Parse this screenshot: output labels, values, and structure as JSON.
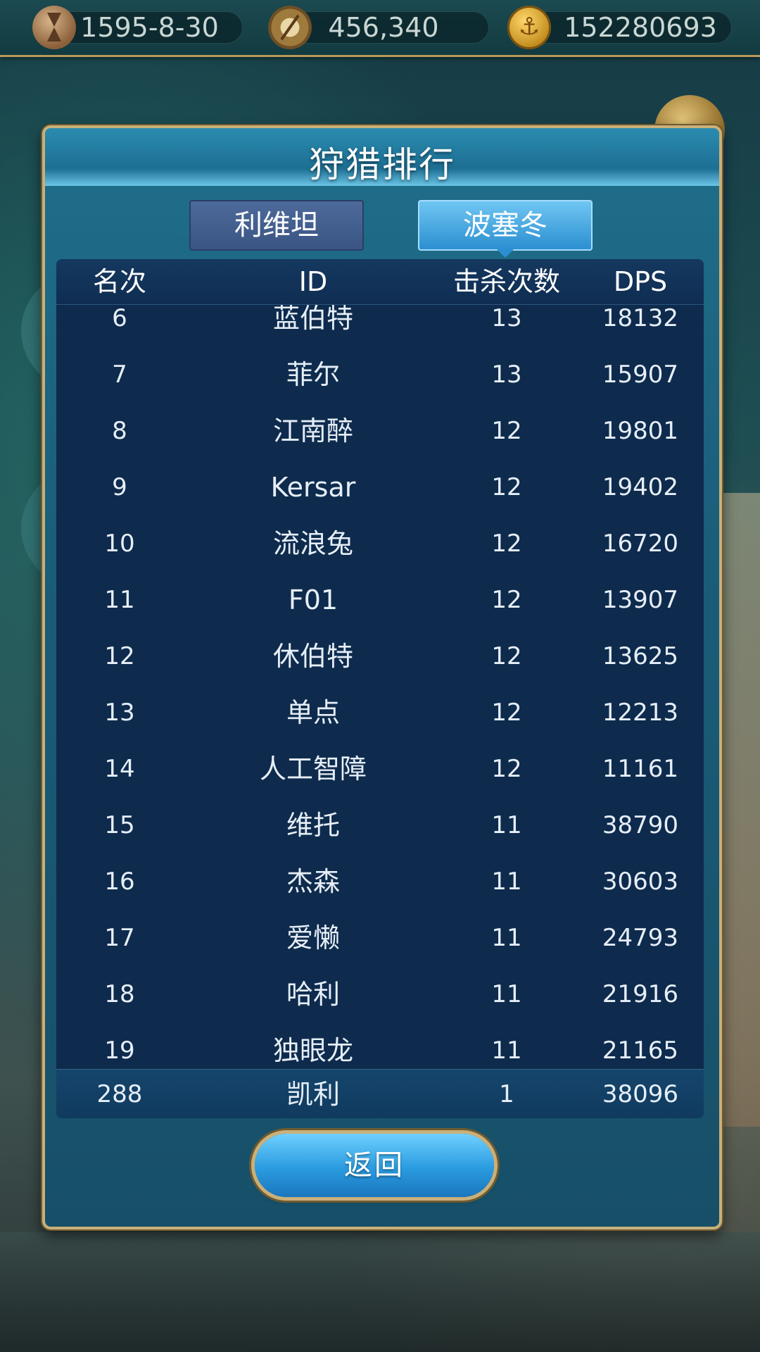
{
  "resources": {
    "date": "1595-8-30",
    "compass_value": "456,340",
    "gold": "152280693"
  },
  "panel": {
    "title": "狩猎排行",
    "tabs": [
      "利维坦",
      "波塞冬"
    ],
    "selected_tab": "波塞冬"
  },
  "table": {
    "headers": [
      "名次",
      "ID",
      "击杀次数",
      "DPS"
    ],
    "rows": [
      {
        "rank": "6",
        "name": "蓝伯特",
        "kills": "13",
        "dps": "18132"
      },
      {
        "rank": "7",
        "name": "菲尔",
        "kills": "13",
        "dps": "15907"
      },
      {
        "rank": "8",
        "name": "江南醉",
        "kills": "12",
        "dps": "19801"
      },
      {
        "rank": "9",
        "name": "Kersar",
        "kills": "12",
        "dps": "19402"
      },
      {
        "rank": "10",
        "name": "流浪兔",
        "kills": "12",
        "dps": "16720"
      },
      {
        "rank": "11",
        "name": "F01",
        "kills": "12",
        "dps": "13907"
      },
      {
        "rank": "12",
        "name": "休伯特",
        "kills": "12",
        "dps": "13625"
      },
      {
        "rank": "13",
        "name": "单点",
        "kills": "12",
        "dps": "12213"
      },
      {
        "rank": "14",
        "name": "人工智障",
        "kills": "12",
        "dps": "11161"
      },
      {
        "rank": "15",
        "name": "维托",
        "kills": "11",
        "dps": "38790"
      },
      {
        "rank": "16",
        "name": "杰森",
        "kills": "11",
        "dps": "30603"
      },
      {
        "rank": "17",
        "name": "爱懒",
        "kills": "11",
        "dps": "24793"
      },
      {
        "rank": "18",
        "name": "哈利",
        "kills": "11",
        "dps": "21916"
      },
      {
        "rank": "19",
        "name": "独眼龙",
        "kills": "11",
        "dps": "21165"
      }
    ],
    "self_row": {
      "rank": "288",
      "name": "凯利",
      "kills": "1",
      "dps": "38096"
    }
  },
  "buttons": {
    "back_label": "返回"
  }
}
